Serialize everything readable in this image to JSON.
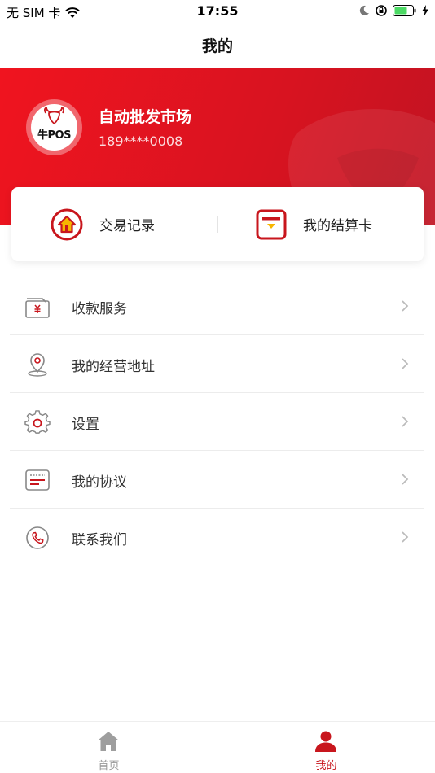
{
  "status_bar": {
    "carrier": "无 SIM 卡",
    "time": "17:55"
  },
  "nav": {
    "title": "我的"
  },
  "profile": {
    "logo_text": "牛POS",
    "merchant_name": "自动批发市场",
    "phone": "189****0008"
  },
  "quick_actions": [
    {
      "label": "交易记录",
      "icon": "house-circle-icon"
    },
    {
      "label": "我的结算卡",
      "icon": "card-icon"
    }
  ],
  "menu": [
    {
      "label": "收款服务",
      "icon": "wallet-yuan-icon"
    },
    {
      "label": "我的经营地址",
      "icon": "location-pin-icon"
    },
    {
      "label": "设置",
      "icon": "gear-icon"
    },
    {
      "label": "我的协议",
      "icon": "document-icon"
    },
    {
      "label": "联系我们",
      "icon": "phone-icon"
    }
  ],
  "tab_bar": [
    {
      "label": "首页",
      "icon": "home-icon",
      "active": false
    },
    {
      "label": "我的",
      "icon": "person-icon",
      "active": true
    }
  ],
  "colors": {
    "brand_red": "#d81320",
    "icon_red": "#c8161d",
    "icon_gray": "#999999",
    "accent_yellow": "#f7b500"
  }
}
